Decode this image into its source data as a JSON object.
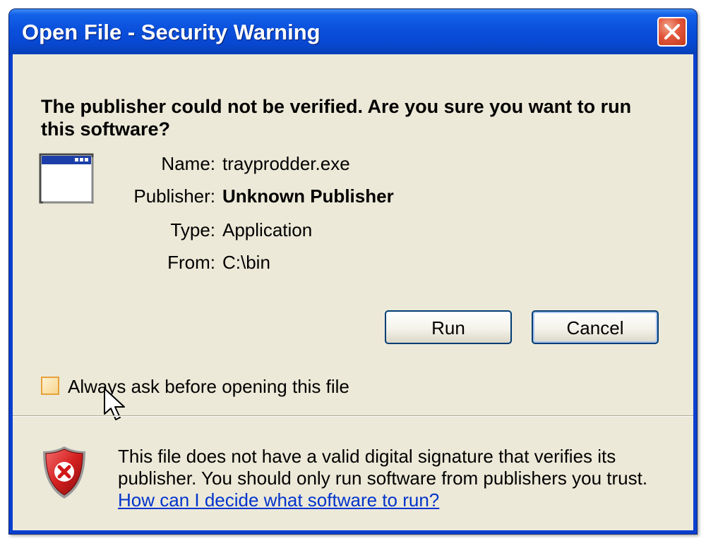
{
  "window": {
    "title": "Open File - Security Warning"
  },
  "dialog": {
    "heading": "The publisher could not be verified.  Are you sure you want to run this software?",
    "file_icon": "application-window-icon",
    "details": {
      "name_label": "Name:",
      "name_value": "trayprodder.exe",
      "publisher_label": "Publisher:",
      "publisher_value": "Unknown Publisher",
      "type_label": "Type:",
      "type_value": "Application",
      "from_label": "From:",
      "from_value": "C:\\bin"
    },
    "buttons": {
      "run": "Run",
      "cancel": "Cancel"
    },
    "checkbox": {
      "label": "Always ask before opening this file",
      "checked": false
    },
    "warning": {
      "icon": "shield-x-icon",
      "line1": "This file does not have a valid digital signature that verifies its",
      "line2": "publisher.  You should only run software from publishers you trust.",
      "link": "How can I decide what software to run?"
    }
  },
  "colors": {
    "titlebar": "#0a50dc",
    "client_bg": "#ece9d8",
    "button_border": "#003c74",
    "link": "#0033cc",
    "close_button": "#e2553a",
    "checkbox_border": "#e6a23a"
  }
}
